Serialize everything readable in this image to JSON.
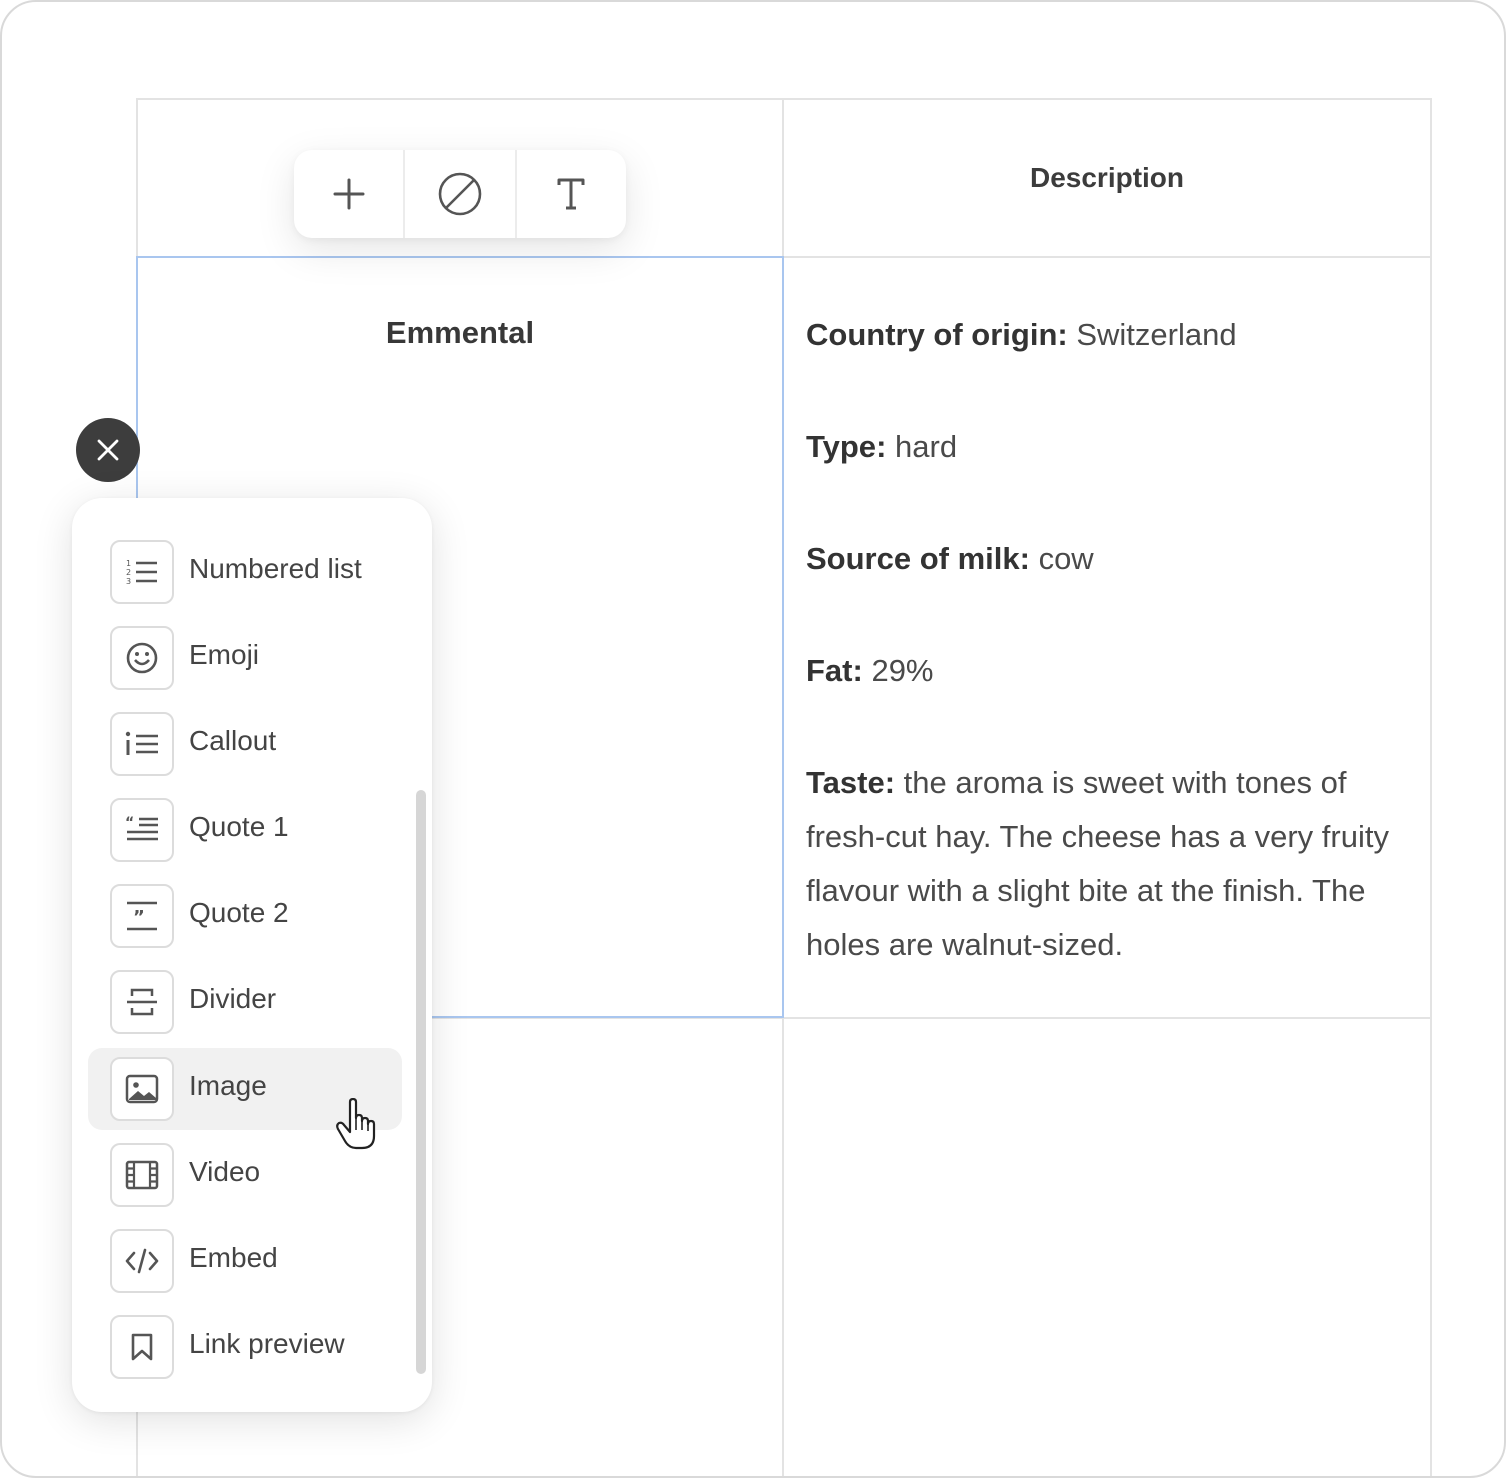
{
  "toolbar": {
    "buttons": [
      {
        "name": "add",
        "icon": "plus-icon"
      },
      {
        "name": "clear",
        "icon": "no-style-icon"
      },
      {
        "name": "text",
        "icon": "text-type-icon"
      }
    ]
  },
  "table": {
    "header_description": "Description",
    "row": {
      "name": "Emmental",
      "description": [
        {
          "label": "Country of origin",
          "value": "Switzerland"
        },
        {
          "label": "Type",
          "value": "hard"
        },
        {
          "label": "Source of milk",
          "value": "cow"
        },
        {
          "label": "Fat",
          "value": "29%"
        },
        {
          "label": "Taste",
          "value": "the aroma is sweet with tones of fresh-cut hay. The cheese has a very fruity flavour with a slight bite at the finish. The holes are walnut-sized."
        }
      ]
    }
  },
  "close_button": {
    "icon": "close-icon"
  },
  "menu": {
    "items": [
      {
        "label": "Numbered list",
        "icon": "numbered-list-icon"
      },
      {
        "label": "Emoji",
        "icon": "emoji-icon"
      },
      {
        "label": "Callout",
        "icon": "callout-icon"
      },
      {
        "label": "Quote 1",
        "icon": "quote-1-icon"
      },
      {
        "label": "Quote 2",
        "icon": "quote-2-icon"
      },
      {
        "label": "Divider",
        "icon": "divider-icon"
      },
      {
        "label": "Image",
        "icon": "image-icon",
        "hovered": true
      },
      {
        "label": "Video",
        "icon": "video-icon"
      },
      {
        "label": "Embed",
        "icon": "embed-icon"
      },
      {
        "label": "Link preview",
        "icon": "bookmark-icon"
      }
    ]
  },
  "colors": {
    "selection_border": "#a9c6ef",
    "close_button_bg": "#3d3d3d",
    "hover_bg": "#f1f1f1"
  }
}
